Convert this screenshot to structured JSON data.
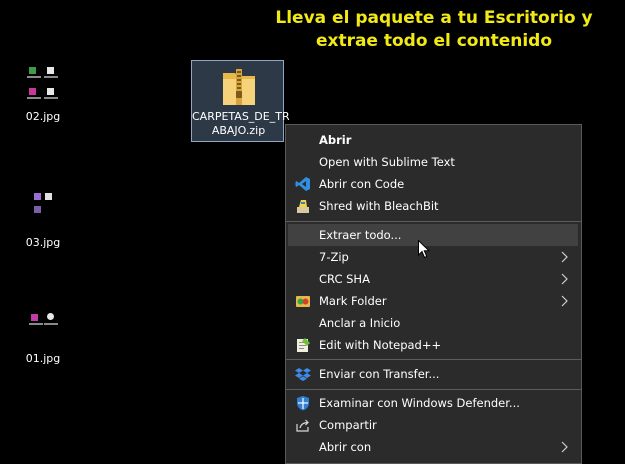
{
  "instruction": {
    "line1": "Lleva el paquete a tu Escritorio y",
    "line2": "extrae todo el contenido",
    "color": "#f2ea14"
  },
  "desktop_icons": [
    {
      "label": "02.jpg"
    },
    {
      "label": "03.jpg"
    },
    {
      "label": "01.jpg"
    }
  ],
  "zip_file": {
    "name_line1": "CARPETAS_DE_TR",
    "name_line2": "ABAJO.zip"
  },
  "context_menu": {
    "items": [
      {
        "label": "Abrir",
        "bold": true
      },
      {
        "label": "Open with Sublime Text"
      },
      {
        "label": "Abrir con Code",
        "icon": "vscode-icon"
      },
      {
        "label": "Shred with BleachBit",
        "icon": "bleachbit-icon"
      },
      {
        "label": "Extraer todo...",
        "hovered": true
      },
      {
        "label": "7-Zip",
        "submenu": true
      },
      {
        "label": "CRC SHA",
        "submenu": true
      },
      {
        "label": "Mark Folder",
        "icon": "mark-folder-icon",
        "submenu": true
      },
      {
        "label": "Anclar a Inicio"
      },
      {
        "label": "Edit with Notepad++",
        "icon": "notepad-plus-icon"
      },
      {
        "label": "Enviar con Transfer...",
        "icon": "dropbox-icon"
      },
      {
        "label": "Examinar con Windows Defender...",
        "icon": "windows-defender-icon"
      },
      {
        "label": "Compartir",
        "icon": "share-icon"
      },
      {
        "label": "Abrir con",
        "submenu": true
      }
    ]
  }
}
